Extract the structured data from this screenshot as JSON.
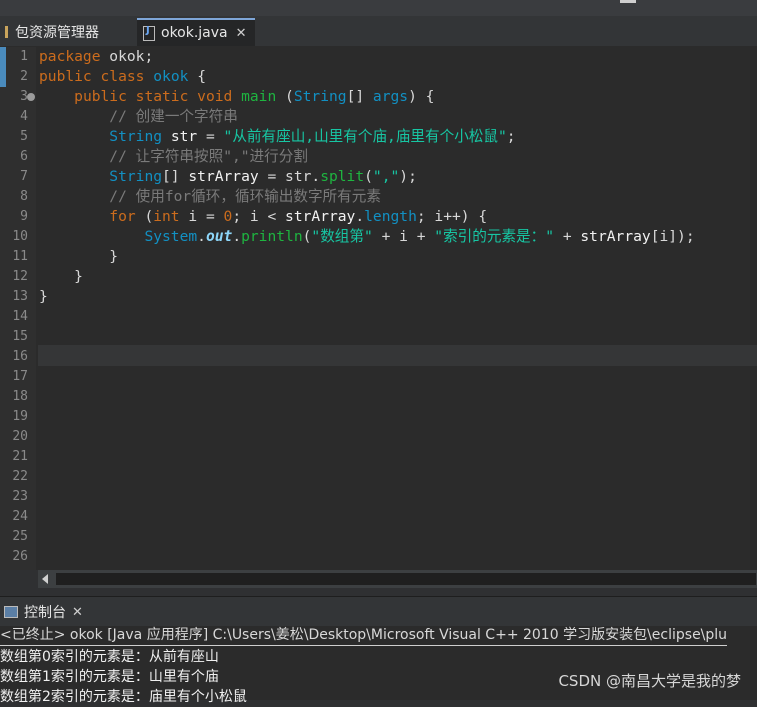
{
  "tabs": {
    "package_explorer": "包资源管理器",
    "editor_file": "okok.java"
  },
  "editor": {
    "line_numbers": [
      "1",
      "2",
      "3",
      "4",
      "5",
      "6",
      "7",
      "8",
      "9",
      "10",
      "11",
      "12",
      "13",
      "14",
      "15",
      "16",
      "17",
      "18",
      "19",
      "20",
      "21",
      "22",
      "23",
      "24",
      "25",
      "26"
    ],
    "code": {
      "l1_kw": "package",
      "l1_rest": " okok;",
      "l2_kw1": "public",
      "l2_kw2": "class",
      "l2_name": "okok",
      "l2_rest": " {",
      "l3_kw": "public static void",
      "l3_fn": "main",
      "l3_ty": "String",
      "l3_mid": "[] ",
      "l3_arg": "args",
      "l3_end": ") {",
      "l4_cm": "// 创建一个字符串",
      "l5_ty": "String",
      "l5_var": "str",
      "l5_eq": " = ",
      "l5_st": "\"从前有座山,山里有个庙,庙里有个小松鼠\"",
      "l5_end": ";",
      "l6_cm": "// 让字符串按照\",\"进行分割",
      "l7_ty": "String",
      "l7_br": "[] ",
      "l7_var": "strArray",
      "l7_mid": " = str.",
      "l7_fn": "split",
      "l7_open": "(",
      "l7_st": "\",\"",
      "l7_end": ");",
      "l8_cm": "// 使用for循环，循环输出数字所有元素",
      "l9_kw": "for",
      "l9_open": " (",
      "l9_kw2": "int",
      "l9_i": " i = ",
      "l9_zero": "0",
      "l9_mid": "; i < ",
      "l9_arr": "strArray",
      "l9_dot": ".",
      "l9_len": "length",
      "l9_end": "; i++) {",
      "l10_sys": "System",
      "l10_dot1": ".",
      "l10_out": "out",
      "l10_dot2": ".",
      "l10_fn": "println",
      "l10_open": "(",
      "l10_st1": "\"数组第\"",
      "l10_mid": " + i + ",
      "l10_st2": "\"索引的元素是：\"",
      "l10_plus": " + ",
      "l10_arr": "strArray",
      "l10_end": "[i]);",
      "l11": "}",
      "l12": "}",
      "l13": "}"
    }
  },
  "console": {
    "tab_label": "控制台",
    "header": "<已终止> okok [Java 应用程序] C:\\Users\\姜松\\Desktop\\Microsoft Visual C++ 2010 学习版安装包\\eclipse\\plu",
    "lines": [
      "数组第0索引的元素是：从前有座山",
      "数组第1索引的元素是：山里有个庙",
      "数组第2索引的元素是：庙里有个小松鼠"
    ]
  },
  "watermark": "CSDN @南昌大学是我的梦",
  "colors": {
    "keyword": "#cc6c1d",
    "type": "#1290c3",
    "string": "#17c6a3",
    "comment": "#7a7a7a",
    "method": "#1eb540"
  }
}
